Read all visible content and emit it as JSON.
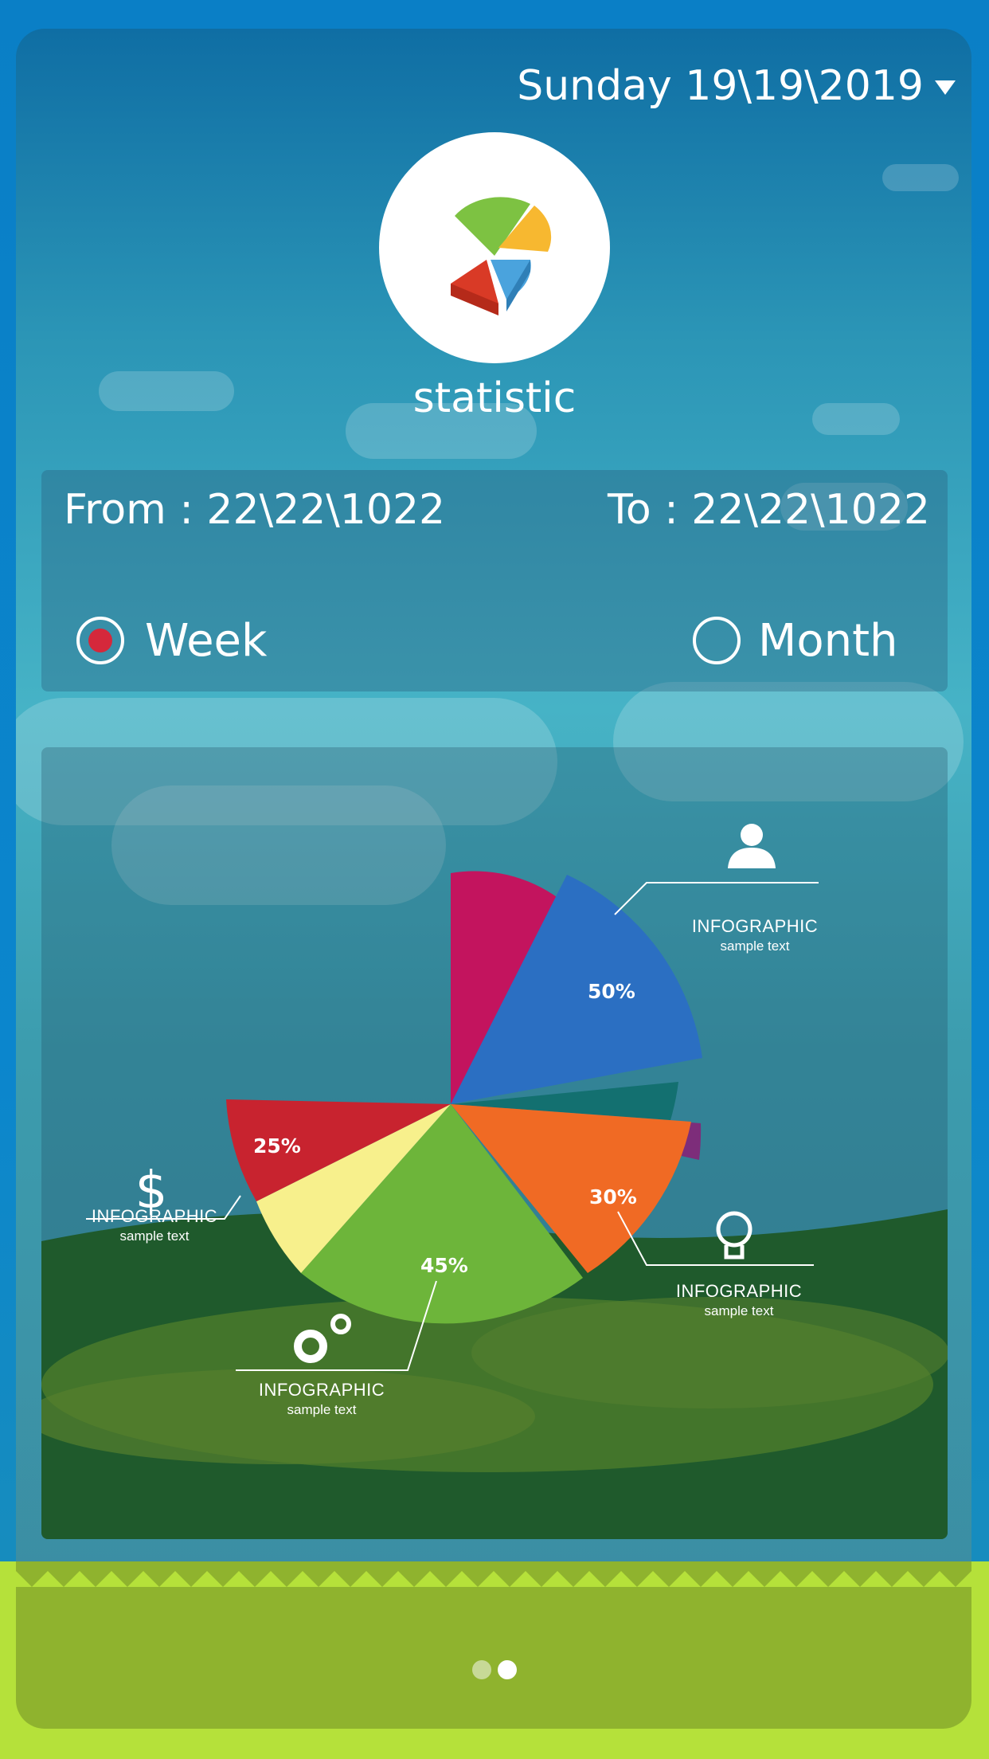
{
  "header": {
    "date": "Sunday 19\\19\\2019"
  },
  "app": {
    "title": "statistic"
  },
  "range": {
    "from_label": "From :",
    "from_value": "22\\22\\1022",
    "to_label": "To :",
    "to_value": "22\\22\\1022"
  },
  "period": {
    "options": [
      "Week",
      "Month"
    ],
    "selected": "Week"
  },
  "colors": {
    "selected_radio": "#d5283b",
    "grass": "#b5e13a"
  },
  "chart_data": {
    "type": "pie",
    "slices": [
      {
        "label": "50%",
        "value": 50,
        "color": "#2b5fb0"
      },
      {
        "label": "25%",
        "value": 25,
        "color": "#c8232f"
      },
      {
        "label": "45%",
        "value": 45,
        "color": "#6db53a"
      },
      {
        "label": "30%",
        "value": 30,
        "color": "#f06a24"
      }
    ],
    "annotations": [
      {
        "icon": "person-icon",
        "title": "INFOGRAPHIC",
        "subtitle": "sample text"
      },
      {
        "icon": "dollar-icon",
        "title": "INFOGRAPHIC",
        "subtitle": "sample text"
      },
      {
        "icon": "gears-icon",
        "title": "INFOGRAPHIC",
        "subtitle": "sample text"
      },
      {
        "icon": "lightbulb-icon",
        "title": "INFOGRAPHIC",
        "subtitle": "sample text"
      }
    ]
  },
  "pager": {
    "count": 2,
    "active": 2
  }
}
